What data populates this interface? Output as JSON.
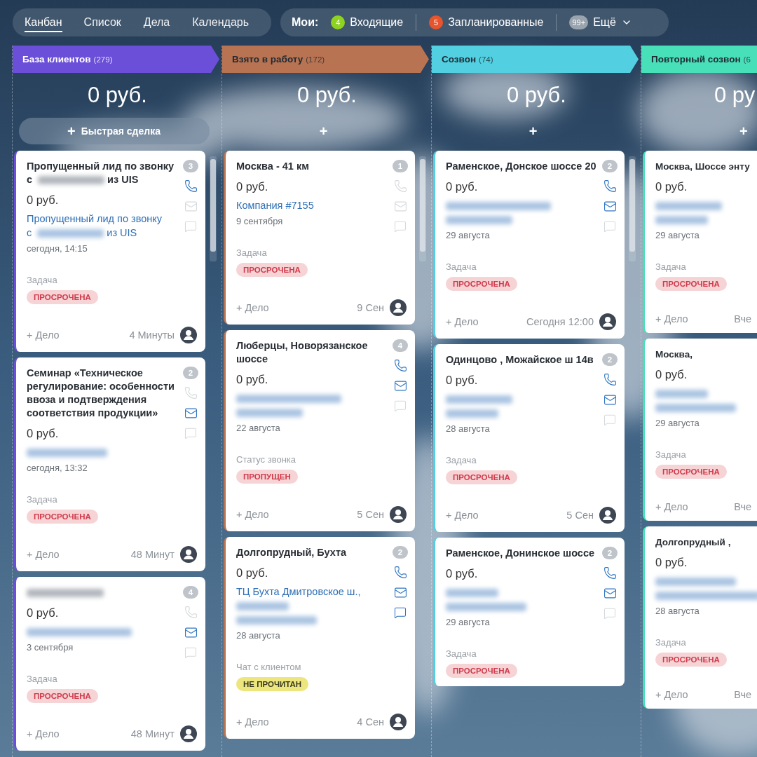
{
  "nav": {
    "tabs": [
      {
        "label": "Канбан",
        "selected": true
      },
      {
        "label": "Список",
        "selected": false
      },
      {
        "label": "Дела",
        "selected": false
      },
      {
        "label": "Календарь",
        "selected": false
      }
    ],
    "mine_label": "Мои:",
    "filters": [
      {
        "badge": "4",
        "color": "#8fd321",
        "label": "Входящие"
      },
      {
        "badge": "5",
        "color": "#e8542b",
        "label": "Запланированные"
      },
      {
        "badge": "99+",
        "color": "#9aa4ae",
        "label": "Ещё",
        "dropdown": true
      }
    ]
  },
  "columns": [
    {
      "title": "База клиентов",
      "count": "(279)",
      "color": "#6b4fd8",
      "total": "0 руб.",
      "add": {
        "icon": "+",
        "label": "Быстрая сделка"
      },
      "cards": [
        {
          "title": [
            {
              "kind": "text",
              "text": "Пропущенный лид по звонку с"
            },
            {
              "kind": "blurred"
            },
            {
              "kind": "text",
              "text": "из UIS"
            }
          ],
          "count": "3",
          "phone": true,
          "mail": false,
          "chat": false,
          "price": "0 руб.",
          "contact": [
            [
              {
                "kind": "text",
                "text": "Пропущенный лид по звонку"
              }
            ],
            [
              {
                "kind": "text",
                "text": "с"
              },
              {
                "kind": "blurred"
              },
              {
                "kind": "text",
                "text": "из UIS"
              }
            ]
          ],
          "date": "сегодня, 14:15",
          "field": "Задача",
          "tag": {
            "text": "ПРОСРОЧЕНА",
            "color": "#f6d3d5"
          },
          "footer": {
            "add": "+ Дело",
            "time": "4 Минуты",
            "avatar": true
          }
        },
        {
          "title": [
            {
              "kind": "text",
              "text": "Семинар «Техническое регулирование: особенности ввоза и подтверждения соответствия продукции»"
            }
          ],
          "count": "2",
          "phone": false,
          "mail": true,
          "chat": false,
          "price": "0 руб.",
          "contact": [
            [
              {
                "kind": "blurred"
              }
            ]
          ],
          "date": "сегодня, 13:32",
          "field": "Задача",
          "tag": {
            "text": "ПРОСРОЧЕНА",
            "color": "#f6d3d5"
          },
          "footer": {
            "add": "+ Дело",
            "time": "48 Минут",
            "avatar": true
          }
        },
        {
          "title": [
            {
              "kind": "blurred"
            }
          ],
          "count": "4",
          "phone": false,
          "mail": true,
          "chat": false,
          "price": "0 руб.",
          "contact": [
            [
              {
                "kind": "blurred"
              }
            ]
          ],
          "date": "3 сентября",
          "field": "Задача",
          "tag": {
            "text": "ПРОСРОЧЕНА",
            "color": "#f6d3d5"
          },
          "footer": {
            "add": "+ Дело",
            "time": "48 Минут",
            "avatar": true
          }
        }
      ]
    },
    {
      "title": "Взято в работу",
      "count": "(172)",
      "color": "#b87352",
      "total": "0 руб.",
      "add": {
        "icon": "+"
      },
      "cards": [
        {
          "title": [
            {
              "kind": "text",
              "text": "Москва - 41 км"
            }
          ],
          "count": "1",
          "phone": false,
          "mail": false,
          "chat": false,
          "price": "0 руб.",
          "contact": [
            [
              {
                "kind": "text",
                "text": "Компания #7155"
              }
            ]
          ],
          "date": "9 сентября",
          "field": "Задача",
          "tag": {
            "text": "ПРОСРОЧЕНА",
            "color": "#f6d3d5"
          },
          "footer": {
            "add": "+ Дело",
            "time": "9 Сен",
            "avatar": true
          }
        },
        {
          "title": [
            {
              "kind": "text",
              "text": "Люберцы, Новорязанское шоссе"
            }
          ],
          "count": "4",
          "phone": true,
          "mail": true,
          "chat": false,
          "price": "0 руб.",
          "contact": [
            [
              {
                "kind": "blurred"
              }
            ],
            [
              {
                "kind": "blurred"
              }
            ]
          ],
          "date": "22 августа",
          "field": "Статус звонка",
          "tag": {
            "text": "ПРОПУЩЕН",
            "color": "#f6d3d5"
          },
          "footer": {
            "add": "+ Дело",
            "time": "5 Сен",
            "avatar": true
          }
        },
        {
          "title": [
            {
              "kind": "text",
              "text": "Долгопрудный, Бухта"
            }
          ],
          "count": "2",
          "phone": true,
          "mail": true,
          "chat": true,
          "price": "0 руб.",
          "contact": [
            [
              {
                "kind": "text",
                "text": "ТЦ Бухта Дмитровское ш.,"
              }
            ],
            [
              {
                "kind": "blurred"
              }
            ],
            [
              {
                "kind": "blurred"
              }
            ]
          ],
          "date": "28 августа",
          "field": "Чат с клиентом",
          "tag": {
            "text": "НЕ ПРОЧИТАН",
            "color": "#ede57e"
          },
          "footer": {
            "add": "+ Дело",
            "time": "4 Сен",
            "avatar": true
          }
        }
      ]
    },
    {
      "title": "Созвон",
      "count": "(74)",
      "color": "#52cfe0",
      "total": "0 руб.",
      "add": {
        "icon": "+"
      },
      "cards": [
        {
          "title": [
            {
              "kind": "text",
              "text": "Раменское, Донское шоссе 20"
            }
          ],
          "count": "2",
          "phone": true,
          "mail": true,
          "chat": false,
          "price": "0 руб.",
          "contact": [
            [
              {
                "kind": "blurred"
              }
            ],
            [
              {
                "kind": "blurred"
              }
            ]
          ],
          "date": "29 августа",
          "field": "Задача",
          "tag": {
            "text": "ПРОСРОЧЕНА",
            "color": "#f6d3d5"
          },
          "footer": {
            "add": "+ Дело",
            "time": "Сегодня 12:00",
            "avatar": true
          }
        },
        {
          "title": [
            {
              "kind": "text",
              "text": "Одинцово , Можайское ш 14в"
            }
          ],
          "count": "2",
          "phone": true,
          "mail": true,
          "chat": false,
          "price": "0 руб.",
          "contact": [
            [
              {
                "kind": "blurred"
              }
            ],
            [
              {
                "kind": "blurred"
              }
            ]
          ],
          "date": "28 августа",
          "field": "Задача",
          "tag": {
            "text": "ПРОСРОЧЕНА",
            "color": "#f6d3d5"
          },
          "footer": {
            "add": "+ Дело",
            "time": "5 Сен",
            "avatar": true
          }
        },
        {
          "title": [
            {
              "kind": "text",
              "text": "Раменское, Донинское шоссе"
            }
          ],
          "count": "2",
          "phone": true,
          "mail": true,
          "chat": false,
          "price": "0 руб.",
          "contact": [
            [
              {
                "kind": "blurred"
              }
            ],
            [
              {
                "kind": "blurred"
              }
            ]
          ],
          "date": "29 августа",
          "field": "Задача",
          "tag": {
            "text": "ПРОСРОЧЕНА",
            "color": "#f6d3d5"
          }
        }
      ]
    },
    {
      "title": "Повторный созвон",
      "count": "(6",
      "color": "#47e0b8",
      "total": "0 ру",
      "add": {
        "icon": "+"
      },
      "cards": [
        {
          "title": [
            {
              "kind": "text",
              "text": "Москва, Шоссе энту"
            }
          ],
          "price": "0 руб.",
          "contact": [
            [
              {
                "kind": "blurred"
              }
            ],
            [
              {
                "kind": "blurred"
              }
            ]
          ],
          "date": "29 августа",
          "field": "Задача",
          "tag": {
            "text": "ПРОСРОЧЕНА",
            "color": "#f6d3d5"
          },
          "footer": {
            "add": "+ Дело",
            "time": "Вче",
            "avatar": false
          }
        },
        {
          "title": [
            {
              "kind": "text",
              "text": "Москва,"
            }
          ],
          "price": "0 руб.",
          "contact": [
            [
              {
                "kind": "blurred"
              }
            ],
            [
              {
                "kind": "blurred"
              }
            ]
          ],
          "date": "29 августа",
          "field": "Задача",
          "tag": {
            "text": "ПРОСРОЧЕНА",
            "color": "#f6d3d5"
          },
          "footer": {
            "add": "+ Дело",
            "time": "Вче",
            "avatar": false
          }
        },
        {
          "title": [
            {
              "kind": "text",
              "text": "Долгопрудный ,"
            }
          ],
          "price": "0 руб.",
          "contact": [
            [
              {
                "kind": "blurred"
              }
            ],
            [
              {
                "kind": "blurred"
              }
            ]
          ],
          "date": "28 августа",
          "field": "Задача",
          "tag": {
            "text": "ПРОСРОЧЕНА",
            "color": "#f6d3d5"
          },
          "footer": {
            "add": "+ Дело",
            "time": "Вче",
            "avatar": false
          }
        }
      ]
    }
  ]
}
